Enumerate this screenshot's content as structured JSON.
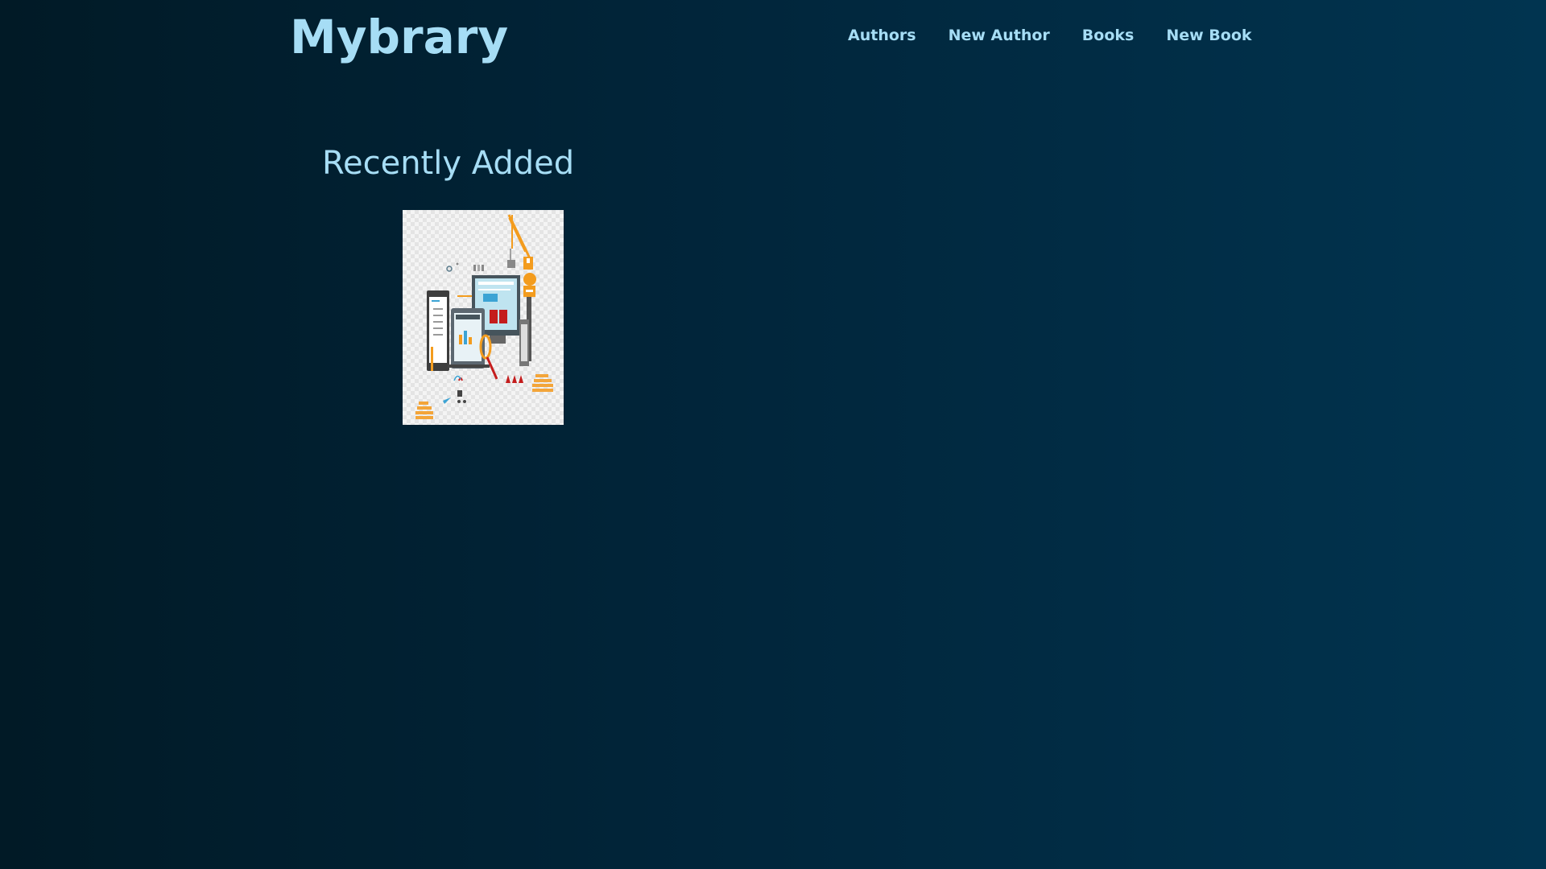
{
  "site": {
    "logo": "Mybrary"
  },
  "nav": {
    "items": [
      {
        "label": "Authors"
      },
      {
        "label": "New Author"
      },
      {
        "label": "Books"
      },
      {
        "label": "New Book"
      }
    ]
  },
  "main": {
    "section_title": "Recently Added",
    "books": [
      {
        "cover_icon": "web-development-illustration-icon"
      }
    ]
  },
  "colors": {
    "text_accent": "#a6ddf5",
    "background_dark": "#011a26",
    "background_light": "#013450"
  }
}
